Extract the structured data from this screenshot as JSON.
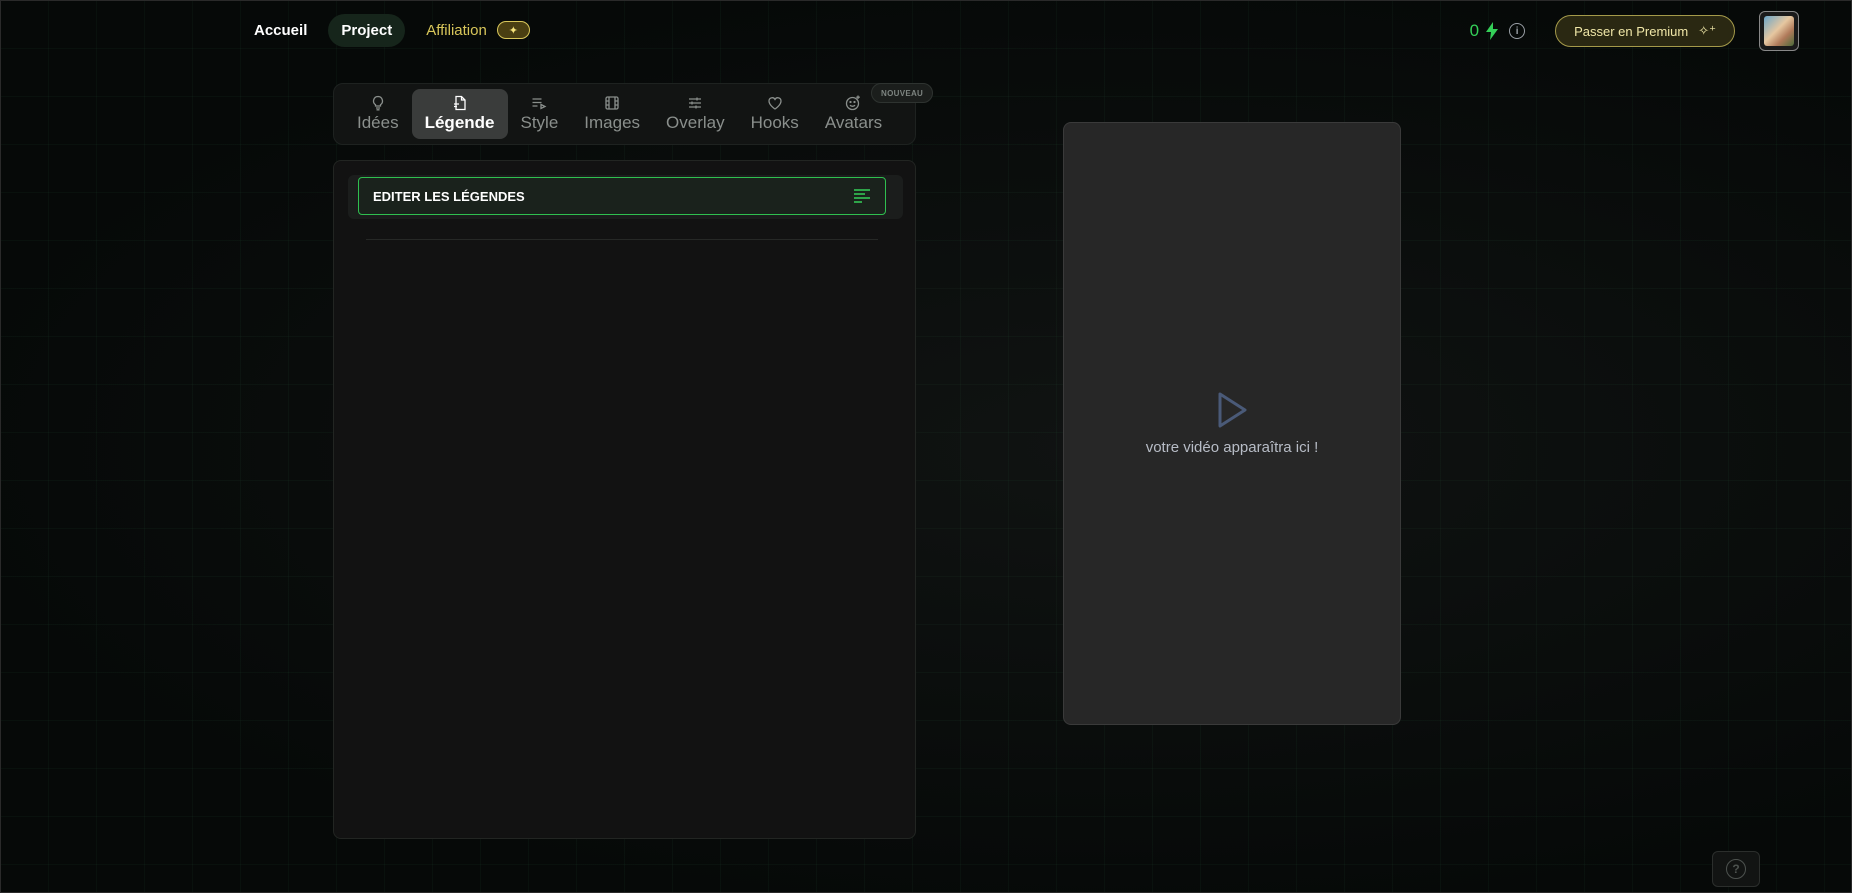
{
  "nav": {
    "home": "Accueil",
    "project": "Project",
    "affiliation": "Affiliation",
    "affiliation_badge": "✦"
  },
  "header": {
    "credits": "0",
    "premium_label": "Passer en Premium",
    "premium_icon": "sparkles-icon"
  },
  "tabs": [
    {
      "label": "Idées",
      "icon": "lightbulb-icon"
    },
    {
      "label": "Légende",
      "icon": "file-caption-icon",
      "active": true
    },
    {
      "label": "Style",
      "icon": "text-play-icon"
    },
    {
      "label": "Images",
      "icon": "film-icon"
    },
    {
      "label": "Overlay",
      "icon": "sliders-icon"
    },
    {
      "label": "Hooks",
      "icon": "heart-icon"
    },
    {
      "label": "Avatars",
      "icon": "smile-plus-icon",
      "badge": "NOUVEAU"
    }
  ],
  "editor": {
    "edit_captions_label": "EDITER LES LÉGENDES"
  },
  "preview": {
    "placeholder": "votre vidéo apparaîtra ici !"
  },
  "colors": {
    "accent_green": "#2fbf4f",
    "premium_gold": "#f0e7a8",
    "affiliation_gold": "#d8c65a"
  }
}
